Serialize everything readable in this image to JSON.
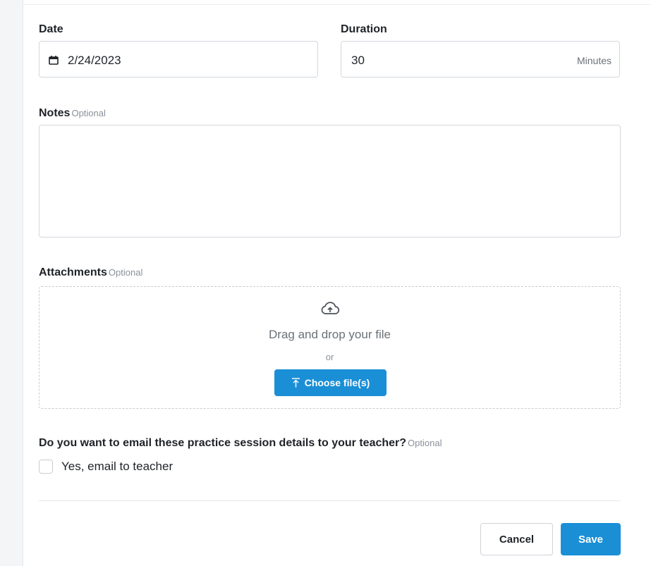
{
  "form": {
    "date": {
      "label": "Date",
      "value": "2/24/2023"
    },
    "duration": {
      "label": "Duration",
      "value": "30",
      "unit": "Minutes"
    },
    "notes": {
      "label": "Notes",
      "optional": "Optional",
      "value": ""
    },
    "attachments": {
      "label": "Attachments",
      "optional": "Optional",
      "drag_text": "Drag and drop your file",
      "or_text": "or",
      "choose_label": "Choose file(s)"
    },
    "email": {
      "question": "Do you want to email these practice session details to your teacher?",
      "optional": "Optional",
      "checkbox_label": "Yes, email to teacher",
      "checked": false
    }
  },
  "actions": {
    "cancel_label": "Cancel",
    "save_label": "Save"
  },
  "icons": {
    "date": "calendar-icon",
    "dropzone": "cloud-upload-icon",
    "choose": "upload-icon"
  },
  "colors": {
    "accent": "#1a8fd6"
  }
}
